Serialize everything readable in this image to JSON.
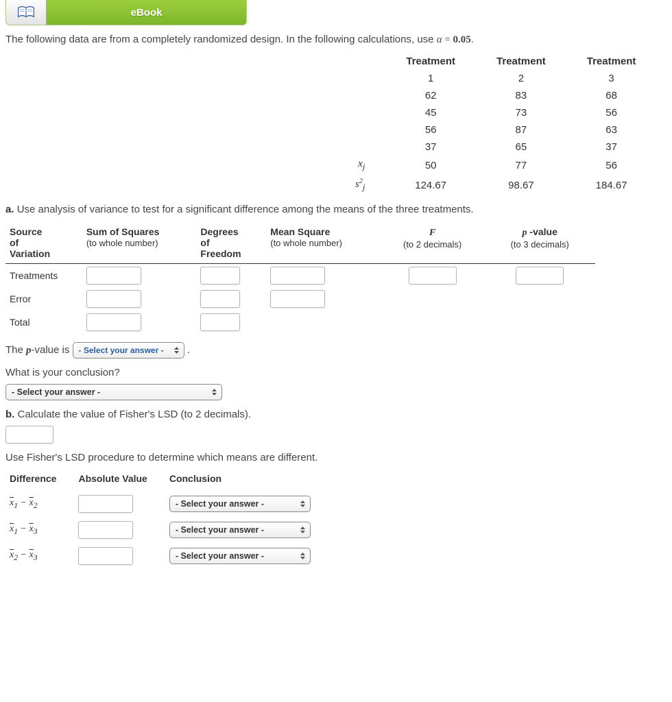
{
  "header": {
    "ebook_label": "eBook"
  },
  "intro_prefix": "The following data are from a completely randomized design. In the following calculations, use ",
  "alpha_expr": "α = 0.05",
  "intro_suffix": ".",
  "data_table": {
    "col_headers": [
      "Treatment",
      "Treatment",
      "Treatment"
    ],
    "col_sub": [
      "1",
      "2",
      "3"
    ],
    "rows": [
      [
        "62",
        "83",
        "68"
      ],
      [
        "45",
        "73",
        "56"
      ],
      [
        "56",
        "87",
        "63"
      ],
      [
        "37",
        "65",
        "37"
      ]
    ],
    "mean_label": "x̄j",
    "mean_row": [
      "50",
      "77",
      "56"
    ],
    "var_label": "s²j",
    "var_row": [
      "124.67",
      "98.67",
      "184.67"
    ]
  },
  "part_a": {
    "label": "a.",
    "text": "Use analysis of variance to test for a significant difference among the means of the three treatments."
  },
  "anova": {
    "headers": {
      "source": "Source of Variation",
      "ss": "Sum of Squares",
      "ss_sub": "(to whole number)",
      "df": "Degrees of Freedom",
      "ms": "Mean Square",
      "ms_sub": "(to whole number)",
      "f": "F",
      "f_sub": "(to 2 decimals)",
      "p": "p -value",
      "p_sub": "(to 3 decimals)"
    },
    "rows": [
      "Treatments",
      "Error",
      "Total"
    ]
  },
  "pvalue_line_prefix": "The ",
  "pvalue_line_mid": "-value is",
  "select_placeholder": "- Select your answer -",
  "conclusion_q": "What is your conclusion?",
  "part_b": {
    "label": "b.",
    "text": "Calculate the value of Fisher's LSD (to 2 decimals)."
  },
  "fisher_intro": "Use Fisher's LSD procedure to determine which means are different.",
  "fisher_table": {
    "h1": "Difference",
    "h2": "Absolute Value",
    "h3": "Conclusion",
    "rows": [
      "x̄1 − x̄2",
      "x̄1 − x̄3",
      "x̄2 − x̄3"
    ]
  }
}
